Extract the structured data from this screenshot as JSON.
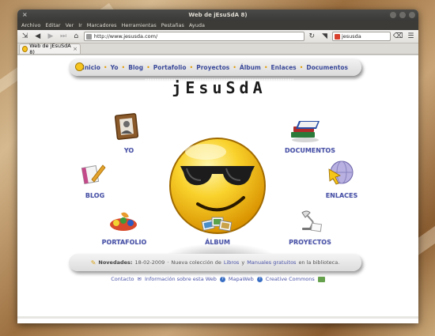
{
  "window": {
    "title": "Web de jEsuSdA 8)",
    "close_glyph": "×"
  },
  "menubar": {
    "items": [
      "Archivo",
      "Editar",
      "Ver",
      "Ir",
      "Marcadores",
      "Herramientas",
      "Pestañas",
      "Ayuda"
    ]
  },
  "toolbar": {
    "url": "http://www.jesusda.com/",
    "search_value": "jesusda"
  },
  "tab": {
    "title": "Web de jEsuSdA 8)",
    "close_glyph": "×"
  },
  "nav": {
    "links": [
      "Inicio",
      "Yo",
      "Blog",
      "Portafolio",
      "Proyectos",
      "Álbum",
      "Enlaces",
      "Documentos"
    ],
    "separator": "•"
  },
  "logo_text": "jEsuSdA",
  "sections": {
    "yo": "YO",
    "documentos": "DOCUMENTOS",
    "blog": "BLOG",
    "enlaces": "ENLACES",
    "portafolio": "PORTAFOLIO",
    "album": "ÁLBUM",
    "proyectos": "PROYECTOS"
  },
  "news": {
    "label": "Novedades:",
    "date": "18-02-2009",
    "sep": "·",
    "text_before": "Nueva colección de",
    "link1": "Libros",
    "text_mid": "y",
    "link2": "Manuales gratuitos",
    "text_after": "en la biblioteca."
  },
  "footer": {
    "contacto": "Contacto",
    "info": "Información sobre esta Web",
    "mapaweb": "MapaWeb",
    "cc": "Creative Commons"
  },
  "colors": {
    "link": "#4a53a7",
    "menu_bg": "#3c3b37",
    "smiley_yellow": "#f7c520"
  }
}
